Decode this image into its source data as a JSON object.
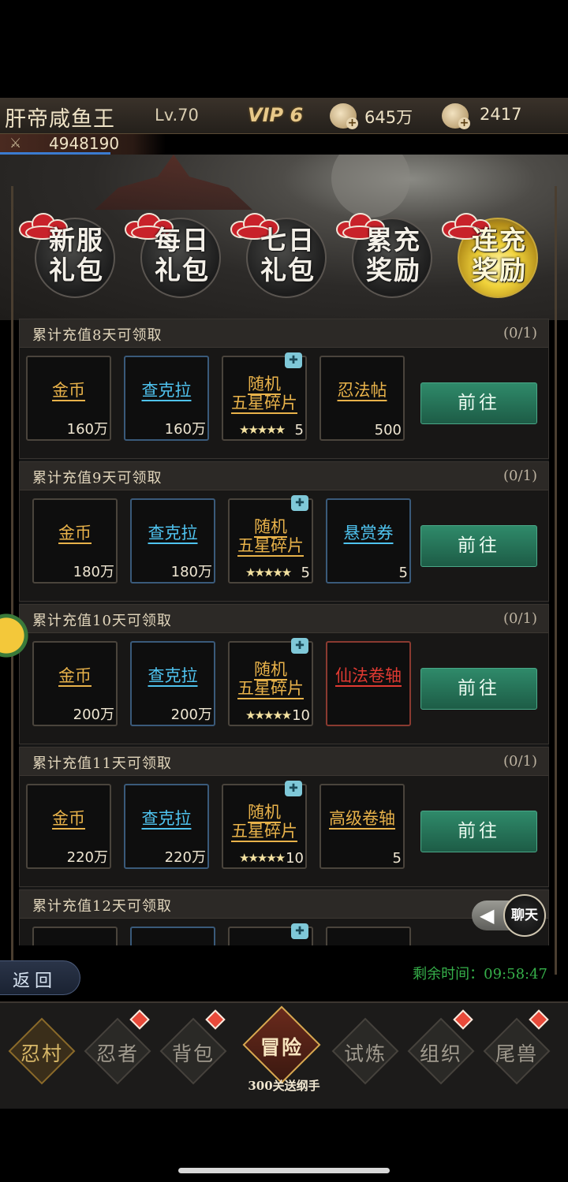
{
  "header": {
    "player_name": "肝帝咸鱼王",
    "level": "Lv.70",
    "vip": "VIP 6",
    "coins": "645万",
    "gems": "2417",
    "power": "4948190",
    "coin_icon": "coin-plus-icon",
    "gem_icon": "ingot-plus-icon"
  },
  "tabs": [
    {
      "label": "新服\n礼包",
      "active": false
    },
    {
      "label": "每日\n礼包",
      "active": false
    },
    {
      "label": "七日\n礼包",
      "active": false
    },
    {
      "label": "累充\n奖励",
      "active": false
    },
    {
      "label": "连充\n奖励",
      "active": true
    }
  ],
  "sections": [
    {
      "title": "累计充值8天可领取",
      "progress": "(0/1)",
      "items": [
        {
          "name": "金币",
          "qty": "160万",
          "color": "gold"
        },
        {
          "name": "查克拉",
          "qty": "160万",
          "color": "blue"
        },
        {
          "name": "随机\n五星碎片",
          "qty": "5",
          "stars": "★★★★★",
          "color": "gold",
          "puzzle": true
        },
        {
          "name": "忍法帖",
          "qty": "500",
          "color": "gold"
        }
      ],
      "button": "前往"
    },
    {
      "title": "累计充值9天可领取",
      "progress": "(0/1)",
      "items": [
        {
          "name": "金币",
          "qty": "180万",
          "color": "gold"
        },
        {
          "name": "查克拉",
          "qty": "180万",
          "color": "blue"
        },
        {
          "name": "随机\n五星碎片",
          "qty": "5",
          "stars": "★★★★★",
          "color": "gold",
          "puzzle": true
        },
        {
          "name": "悬赏券",
          "qty": "5",
          "color": "blue"
        }
      ],
      "button": "前往"
    },
    {
      "title": "累计充值10天可领取",
      "progress": "(0/1)",
      "items": [
        {
          "name": "金币",
          "qty": "200万",
          "color": "gold"
        },
        {
          "name": "查克拉",
          "qty": "200万",
          "color": "blue"
        },
        {
          "name": "随机\n五星碎片",
          "qty": "10",
          "stars": "★★★★★",
          "color": "gold",
          "puzzle": true
        },
        {
          "name": "仙法卷轴",
          "qty": "",
          "color": "red"
        }
      ],
      "button": "前往"
    },
    {
      "title": "累计充值11天可领取",
      "progress": "(0/1)",
      "items": [
        {
          "name": "金币",
          "qty": "220万",
          "color": "gold"
        },
        {
          "name": "查克拉",
          "qty": "220万",
          "color": "blue"
        },
        {
          "name": "随机\n五星碎片",
          "qty": "10",
          "stars": "★★★★★",
          "color": "gold",
          "puzzle": true
        },
        {
          "name": "高级卷轴",
          "qty": "5",
          "color": "gold"
        }
      ],
      "button": "前往"
    },
    {
      "title": "累计充值12天可领取",
      "progress": "",
      "items": [
        {
          "name": "",
          "qty": "",
          "color": "gold"
        },
        {
          "name": "",
          "qty": "",
          "color": "blue"
        },
        {
          "name": "",
          "qty": "",
          "color": "gold",
          "puzzle": true
        },
        {
          "name": "",
          "qty": "",
          "color": "gold"
        }
      ],
      "button": ""
    }
  ],
  "chat": {
    "label": "聊天"
  },
  "back": {
    "label": "返回"
  },
  "timer": "剩余时间：09:58:47",
  "nav": [
    {
      "label": "忍村",
      "badge": false
    },
    {
      "label": "忍者",
      "badge": true
    },
    {
      "label": "背包",
      "badge": true
    },
    {
      "label": "冒险",
      "badge": false,
      "active": true
    },
    {
      "label": "试炼",
      "badge": false
    },
    {
      "label": "组织",
      "badge": true
    },
    {
      "label": "尾兽",
      "badge": true
    }
  ],
  "nav_sub": "300关送纲手",
  "colors": {
    "accent_green": "#2f8a6a",
    "timer_green": "#36b04a",
    "item_gold": "#e8b24a",
    "item_blue": "#4fc3ef",
    "item_red": "#e03a32"
  }
}
